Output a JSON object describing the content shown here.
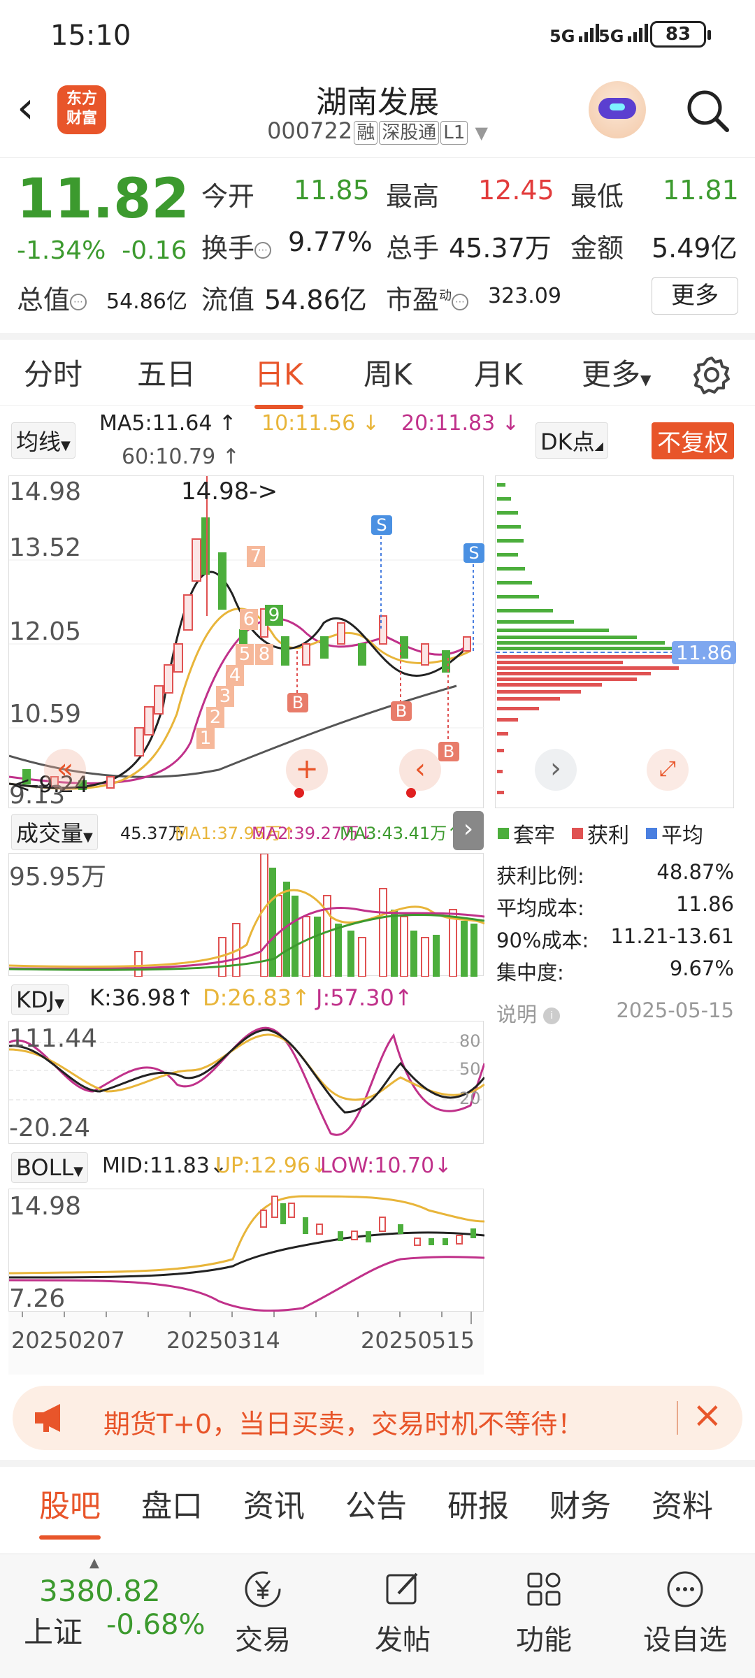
{
  "status": {
    "time": "15:10",
    "net1": "5G",
    "net2": "5G",
    "battery": "83"
  },
  "header": {
    "title": "湖南发展",
    "code": "000722",
    "tags": [
      "融",
      "深股通",
      "L1"
    ],
    "logo_line1": "东方",
    "logo_line2": "财富"
  },
  "quote": {
    "price": "11.82",
    "change_pct": "-1.34%",
    "change": "-0.16",
    "open_label": "今开",
    "open": "11.85",
    "high_label": "最高",
    "high": "12.45",
    "low_label": "最低",
    "low": "11.81",
    "turnover_label": "换手",
    "turnover": "9.77%",
    "volume_label": "总手",
    "volume": "45.37万",
    "amount_label": "金额",
    "amount": "5.49亿",
    "mktcap_label": "总值",
    "mktcap": "54.86亿",
    "float_label": "流值",
    "float": "54.86亿",
    "pe_label": "市盈",
    "pe_sup": "动",
    "pe": "323.09",
    "more": "更多"
  },
  "period_tabs": [
    "分时",
    "五日",
    "日K",
    "周K",
    "月K",
    "更多"
  ],
  "active_period": "日K",
  "ma": {
    "selector": "均线",
    "ma5": "MA5:11.64 ↑",
    "ma10": "10:11.56 ↓",
    "ma20": "20:11.83 ↓",
    "ma60": "60:10.79 ↑",
    "dk": "DK点",
    "fq": "不复权",
    "colors": {
      "ma5": "#222222",
      "ma10": "#e8b53a",
      "ma20": "#c0318a",
      "ma60": "#555555"
    }
  },
  "kchart": {
    "y_labels": [
      "14.98",
      "13.52",
      "12.05",
      "10.59",
      "9.13"
    ],
    "max_label": "14.98->",
    "min_label": "<-9.24",
    "nums": [
      "1",
      "2",
      "3",
      "4",
      "5",
      "6",
      "7",
      "8",
      "9"
    ],
    "markers_s": [
      "S",
      "S"
    ],
    "markers_b": [
      "B",
      "B",
      "B"
    ]
  },
  "chip": {
    "price_label": "11.86",
    "legend": [
      "套牢",
      "获利",
      "平均"
    ],
    "legend_colors": [
      "#4cae3c",
      "#e05252",
      "#4a7fe0"
    ],
    "stats": [
      {
        "label": "获利比例:",
        "value": "48.87%"
      },
      {
        "label": "平均成本:",
        "value": "11.86"
      },
      {
        "label": "90%成本:",
        "value": "11.21-13.61"
      },
      {
        "label": "集中度:",
        "value": "9.67%"
      }
    ],
    "note": "说明",
    "date": "2025-05-15"
  },
  "volume": {
    "selector": "成交量",
    "v": "45.37万",
    "ma1": "MA1:37.95万↑",
    "ma2": "MA2:39.27万↓",
    "ma3": "MA3:43.41万↑",
    "y_max": "95.95万"
  },
  "kdj": {
    "selector": "KDJ",
    "k": "K:36.98↑",
    "d": "D:26.83↑",
    "j": "J:57.30↑",
    "y_top": "111.44",
    "y_bottom": "-20.24",
    "levels": [
      "80",
      "50",
      "20"
    ]
  },
  "boll": {
    "selector": "BOLL",
    "mid": "MID:11.83↓",
    "up": "UP:12.96↓",
    "low": "LOW:10.70↓",
    "y_top": "14.98",
    "y_bottom": "7.26"
  },
  "dates": [
    "20250207",
    "20250314",
    "20250515"
  ],
  "banner": {
    "text": "期货T+0，当日买卖，交易时机不等待！"
  },
  "sub_tabs": [
    "股吧",
    "盘口",
    "资讯",
    "公告",
    "研报",
    "财务",
    "资料"
  ],
  "active_sub_tab": "股吧",
  "bottom": {
    "index_value": "3380.82",
    "index_name": "上证",
    "index_change": "-0.68%",
    "items": [
      "交易",
      "发帖",
      "功能",
      "设自选"
    ]
  }
}
